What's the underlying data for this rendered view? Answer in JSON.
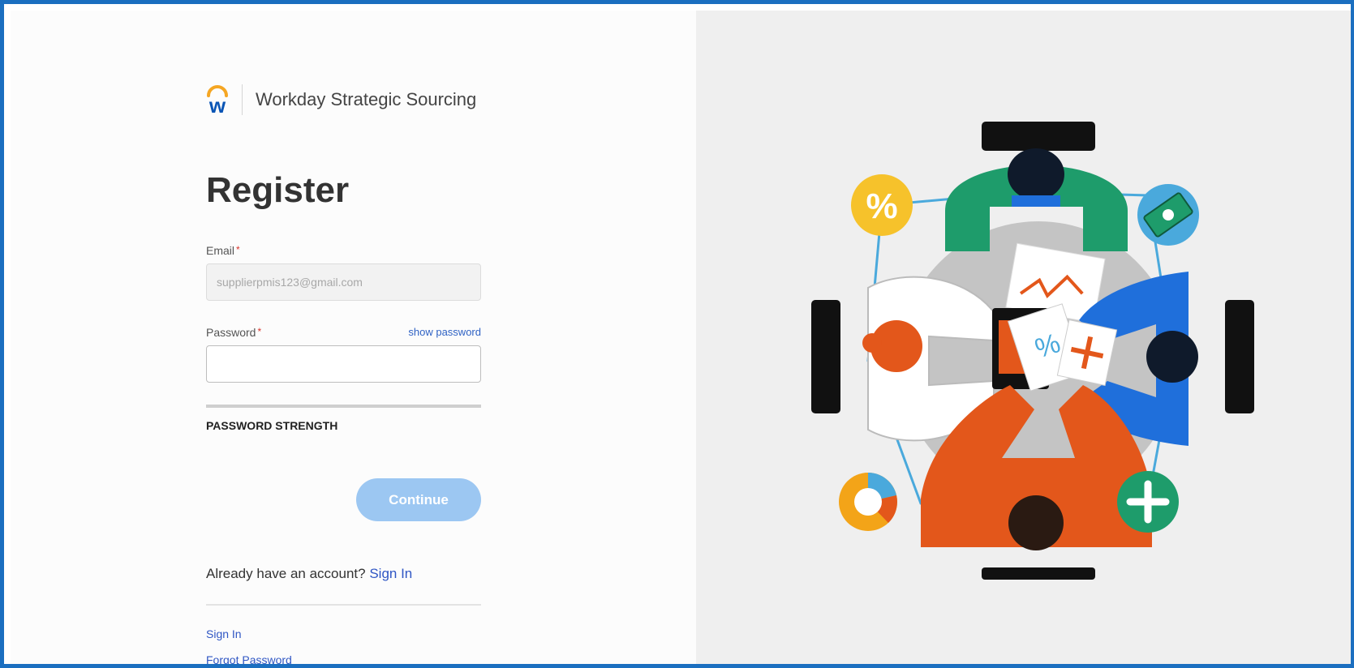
{
  "brand": {
    "logo_letter": "w",
    "name": "Workday Strategic Sourcing"
  },
  "form": {
    "title": "Register",
    "email": {
      "label": "Email",
      "required_mark": "*",
      "value": "supplierpmis123@gmail.com"
    },
    "password": {
      "label": "Password",
      "required_mark": "*",
      "value": "",
      "show_label": "show password"
    },
    "strength_label": "PASSWORD STRENGTH",
    "continue_label": "Continue",
    "already_text": "Already have an account?",
    "already_link": "Sign In"
  },
  "footer_links": {
    "sign_in": "Sign In",
    "forgot_password": "Forgot Password"
  },
  "illustration": {
    "icon_names": [
      "percent-icon",
      "money-icon",
      "pie-chart-icon",
      "plus-icon"
    ],
    "percent_symbol": "%",
    "colors": {
      "green": "#1e9c6b",
      "blue": "#1f6fdb",
      "orange": "#e3571b",
      "yellow": "#f6c22b",
      "table": "#c4c4c4",
      "chair": "#111111",
      "line": "#4aa9dc"
    }
  },
  "colors": {
    "frame_border": "#1b6fc0",
    "link": "#2f56c4",
    "button_disabled": "#9cc7f2",
    "logo_orange": "#f5a623",
    "logo_blue": "#0a55b5"
  }
}
